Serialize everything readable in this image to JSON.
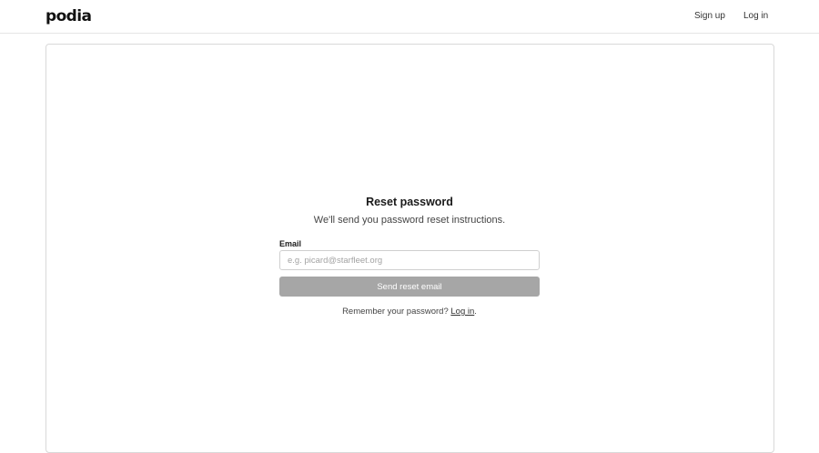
{
  "header": {
    "logo_text": "podia",
    "nav": {
      "signup_label": "Sign up",
      "login_label": "Log in"
    }
  },
  "form": {
    "title": "Reset password",
    "subtitle": "We'll send you password reset instructions.",
    "email_label": "Email",
    "email_value": "",
    "email_placeholder": "e.g. picard@starfleet.org",
    "submit_label": "Send reset email",
    "remember_text": "Remember your password?",
    "remember_link": "Log in",
    "remember_suffix": "."
  },
  "colors": {
    "button_disabled": "#a6a6a6",
    "border": "#d9d9d9",
    "text": "#1f1f1f"
  }
}
